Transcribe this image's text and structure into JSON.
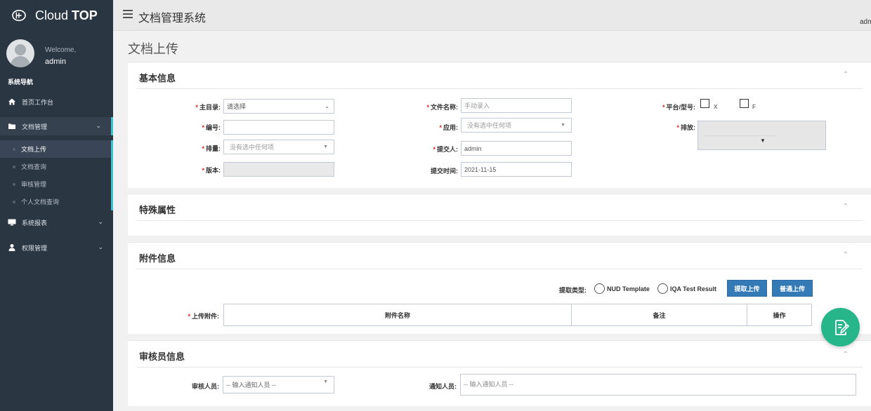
{
  "brand": {
    "prefix": "Cloud",
    "strong": "TOP"
  },
  "user": {
    "welcome": "Welcome,",
    "name": "admin",
    "header_name": "admin"
  },
  "sidebar": {
    "section_title": "系统导航",
    "items": [
      {
        "label": "首页工作台",
        "icon": "home-icon"
      },
      {
        "label": "文档管理",
        "icon": "folder-icon",
        "expanded": true
      },
      {
        "label": "系统报表",
        "icon": "monitor-icon"
      },
      {
        "label": "权限管理",
        "icon": "user-icon"
      }
    ],
    "sub_items": [
      "文档上传",
      "文档查询",
      "审核管理",
      "个人文档查询"
    ],
    "active_sub": "文档上传"
  },
  "header": {
    "title": "文档管理系统"
  },
  "page": {
    "title": "文档上传"
  },
  "basic_info": {
    "title": "基本信息",
    "main_dir": {
      "label": "主目录:",
      "value": "请选择"
    },
    "number": {
      "label": "编号:",
      "value": ""
    },
    "series": {
      "label": "排量:",
      "placeholder": "没有选中任何项"
    },
    "version": {
      "label": "版本:",
      "value": ""
    },
    "file_name": {
      "label": "文件名称:",
      "placeholder": "手动录入"
    },
    "application": {
      "label": "应用:",
      "placeholder": "没有选中任何项"
    },
    "submitter": {
      "label": "提交人:",
      "value": "admin"
    },
    "submit_time": {
      "label": "提交时间:",
      "value": "2021-11-15"
    },
    "platform": {
      "label": "平台/型号:",
      "options": [
        "X",
        "F"
      ]
    },
    "emission": {
      "label": "排放:"
    }
  },
  "special": {
    "title": "特殊属性"
  },
  "attachment": {
    "title": "附件信息",
    "extract_type_label": "提取类型:",
    "radio_options": [
      "NUD Template",
      "IQA Test Result"
    ],
    "extract_upload_btn": "提取上传",
    "normal_upload_btn": "普通上传",
    "upload_label": "上传附件:",
    "columns": [
      "附件名称",
      "备注",
      "操作"
    ]
  },
  "reviewer": {
    "title": "审核员信息",
    "reviewer_label": "审核人员:",
    "reviewer_placeholder": "-- 输入通知人员 --",
    "notify_label": "通知人员:",
    "notify_placeholder": "-- 输入通知人员 --"
  },
  "colors": {
    "sidebar_bg": "#2b3643",
    "accent": "#36c6d3",
    "primary_btn": "#337ab7",
    "fab": "#26b68a",
    "required": "#e02222"
  }
}
